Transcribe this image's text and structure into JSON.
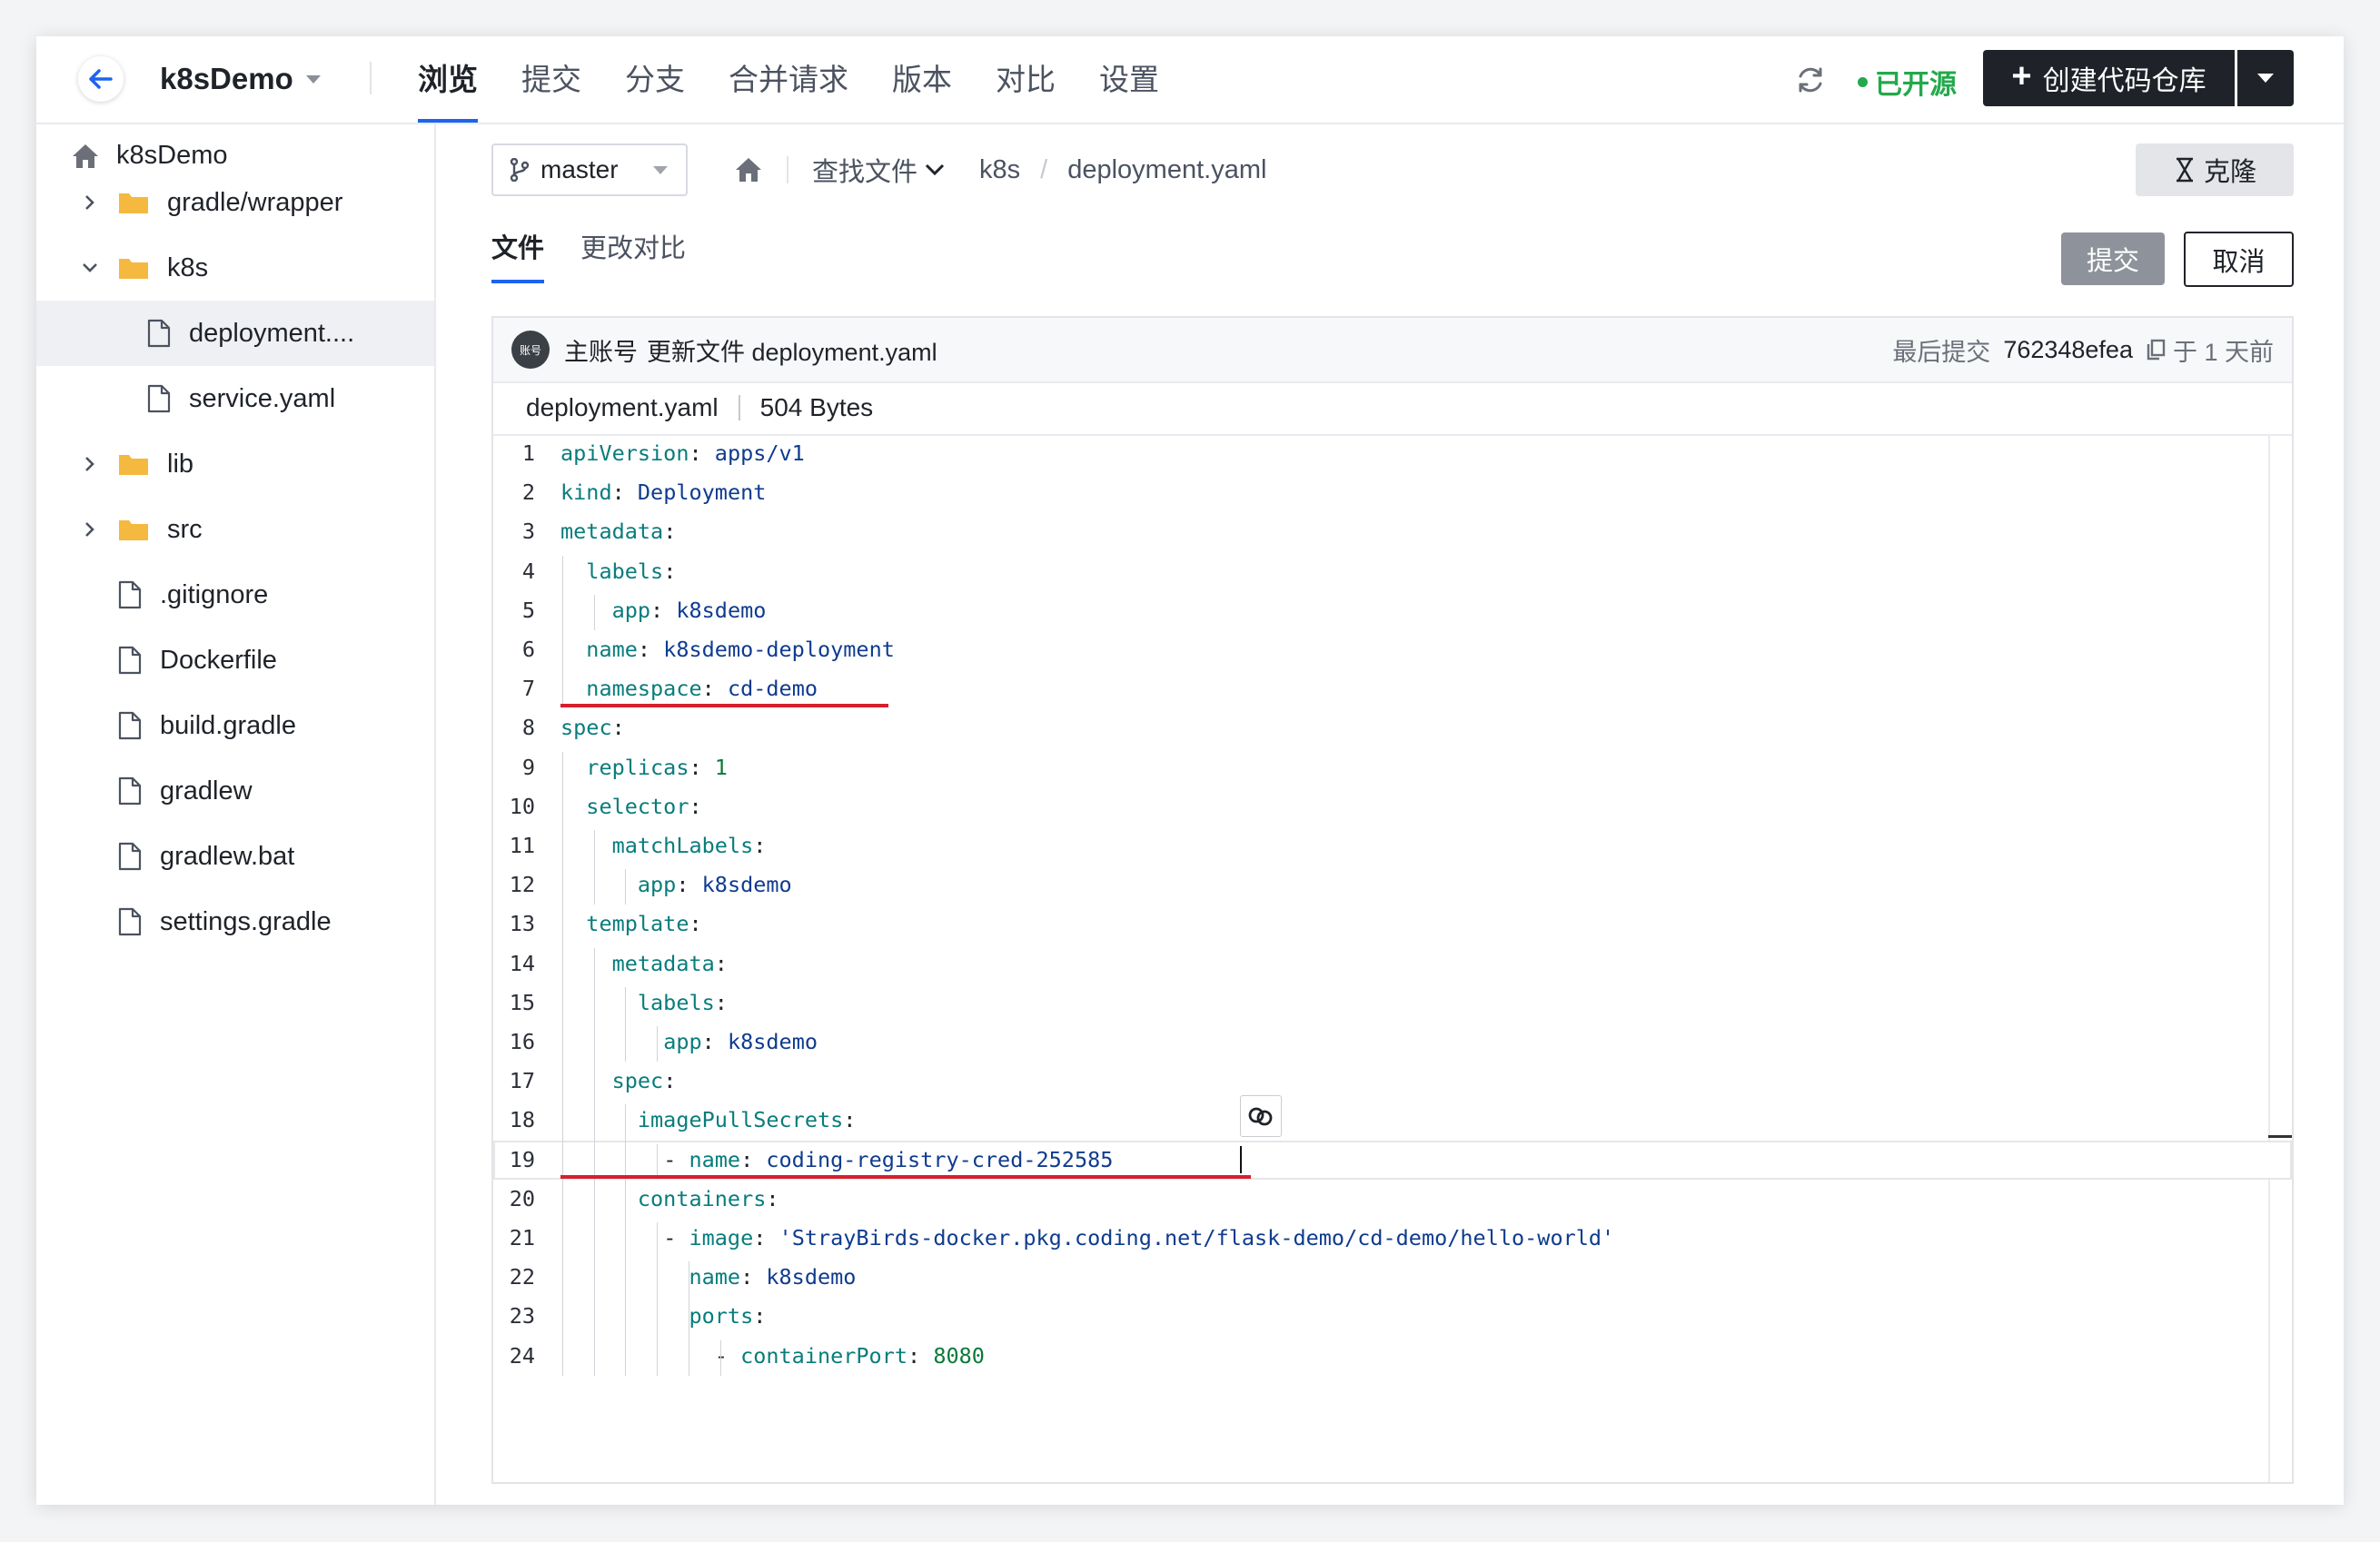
{
  "header": {
    "repo_name": "k8sDemo",
    "nav_tabs": [
      "浏览",
      "提交",
      "分支",
      "合并请求",
      "版本",
      "对比",
      "设置"
    ],
    "active_tab": "浏览",
    "open_source_label": "已开源",
    "create_repo_label": "创建代码仓库",
    "accent": "#1d63ed",
    "open_color": "#23a94b"
  },
  "sidebar": {
    "root": "k8sDemo",
    "items": [
      {
        "label": "gradle/wrapper",
        "type": "folder",
        "expanded": false,
        "depth": 0
      },
      {
        "label": "k8s",
        "type": "folder",
        "expanded": true,
        "depth": 0
      },
      {
        "label": "deployment....",
        "type": "file",
        "depth": 1,
        "selected": true
      },
      {
        "label": "service.yaml",
        "type": "file",
        "depth": 1
      },
      {
        "label": "lib",
        "type": "folder",
        "expanded": false,
        "depth": 0
      },
      {
        "label": "src",
        "type": "folder",
        "expanded": false,
        "depth": 0
      },
      {
        "label": ".gitignore",
        "type": "file",
        "depth": 0
      },
      {
        "label": "Dockerfile",
        "type": "file",
        "depth": 0
      },
      {
        "label": "build.gradle",
        "type": "file",
        "depth": 0
      },
      {
        "label": "gradlew",
        "type": "file",
        "depth": 0
      },
      {
        "label": "gradlew.bat",
        "type": "file",
        "depth": 0
      },
      {
        "label": "settings.gradle",
        "type": "file",
        "depth": 0
      }
    ]
  },
  "toolbar": {
    "branch": "master",
    "find_file": "查找文件",
    "breadcrumb_dir": "k8s",
    "breadcrumb_file": "deployment.yaml",
    "clone_label": "克隆",
    "sub_tabs": [
      "文件",
      "更改对比"
    ],
    "submit_label": "提交",
    "cancel_label": "取消"
  },
  "commit": {
    "avatar_text": "账号",
    "author": "主账号",
    "message": "更新文件 deployment.yaml",
    "last_commit_label": "最后提交",
    "hash": "762348efea",
    "time": "于 1 天前"
  },
  "file": {
    "name": "deployment.yaml",
    "size": "504 Bytes",
    "current_line": 19,
    "lines": [
      {
        "indent": 0,
        "key": "apiVersion",
        "value": "apps/v1"
      },
      {
        "indent": 0,
        "key": "kind",
        "value": "Deployment"
      },
      {
        "indent": 0,
        "key": "metadata",
        "value": ""
      },
      {
        "indent": 1,
        "key": "labels",
        "value": ""
      },
      {
        "indent": 2,
        "key": "app",
        "value": "k8sdemo"
      },
      {
        "indent": 1,
        "key": "name",
        "value": "k8sdemo-deployment"
      },
      {
        "indent": 1,
        "key": "namespace",
        "value": "cd-demo"
      },
      {
        "indent": 0,
        "key": "spec",
        "value": ""
      },
      {
        "indent": 1,
        "key": "replicas",
        "value": "1",
        "numeric": true
      },
      {
        "indent": 1,
        "key": "selector",
        "value": ""
      },
      {
        "indent": 2,
        "key": "matchLabels",
        "value": ""
      },
      {
        "indent": 3,
        "key": "app",
        "value": "k8sdemo"
      },
      {
        "indent": 1,
        "key": "template",
        "value": ""
      },
      {
        "indent": 2,
        "key": "metadata",
        "value": ""
      },
      {
        "indent": 3,
        "key": "labels",
        "value": ""
      },
      {
        "indent": 4,
        "key": "app",
        "value": "k8sdemo"
      },
      {
        "indent": 2,
        "key": "spec",
        "value": ""
      },
      {
        "indent": 3,
        "key": "imagePullSecrets",
        "value": ""
      },
      {
        "indent": 4,
        "dash": true,
        "key": "name",
        "value": "coding-registry-cred-252585"
      },
      {
        "indent": 3,
        "key": "containers",
        "value": ""
      },
      {
        "indent": 4,
        "dash": true,
        "key": "image",
        "value": "'StrayBirds-docker.pkg.coding.net/flask-demo/cd-demo/hello-world'"
      },
      {
        "indent": 5,
        "key": "name",
        "value": "k8sdemo"
      },
      {
        "indent": 5,
        "key": "ports",
        "value": ""
      },
      {
        "indent": 6,
        "dash": true,
        "key": "containerPort",
        "value": "8080",
        "numeric": true
      }
    ]
  }
}
